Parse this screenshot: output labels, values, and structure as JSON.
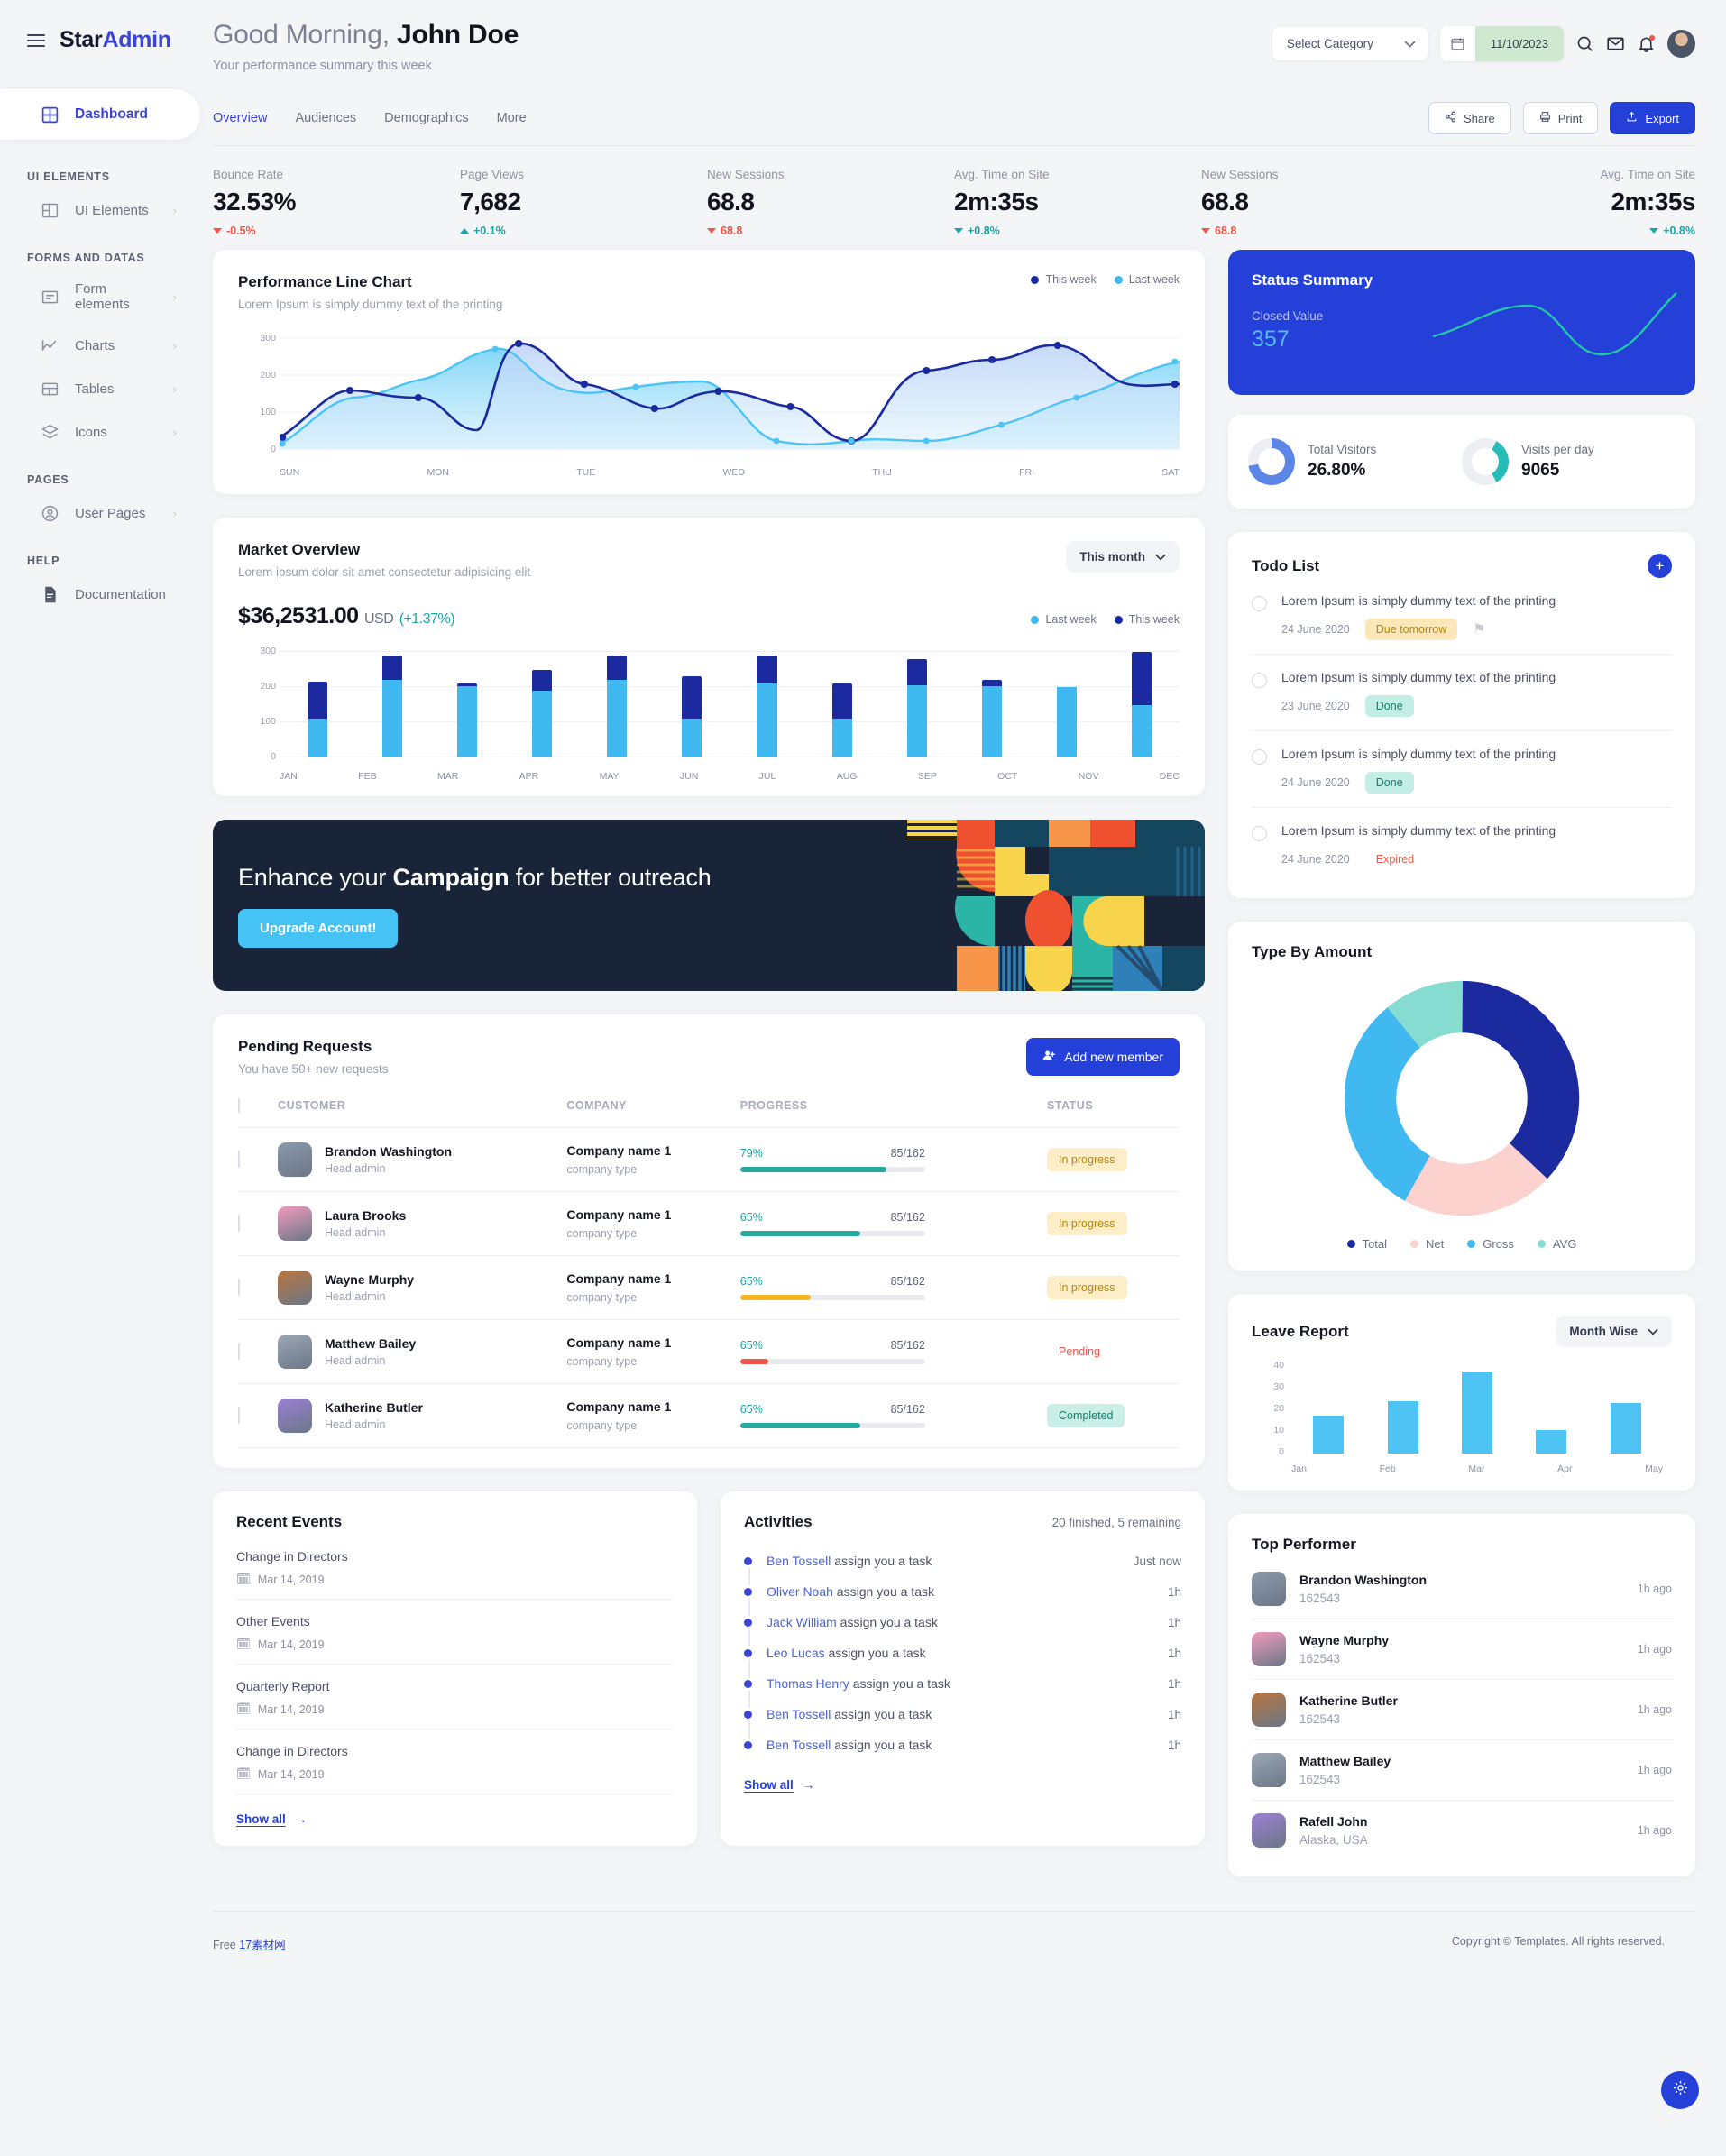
{
  "brand": {
    "star": "Star",
    "admin": "Admin"
  },
  "sidebar": {
    "active": {
      "label": "Dashboard",
      "icon": "grid-icon"
    },
    "sections": [
      {
        "title": "UI ELEMENTS",
        "items": [
          {
            "label": "UI Elements",
            "icon": "layout-icon"
          }
        ]
      },
      {
        "title": "FORMS AND DATAS",
        "items": [
          {
            "label": "Form elements",
            "icon": "form-icon"
          },
          {
            "label": "Charts",
            "icon": "chart-line-icon"
          },
          {
            "label": "Tables",
            "icon": "table-icon"
          },
          {
            "label": "Icons",
            "icon": "layers-icon"
          }
        ]
      },
      {
        "title": "PAGES",
        "items": [
          {
            "label": "User Pages",
            "icon": "user-circle-icon"
          }
        ]
      },
      {
        "title": "HELP",
        "items": [
          {
            "label": "Documentation",
            "icon": "document-icon"
          }
        ]
      }
    ]
  },
  "header": {
    "greeting_prefix": "Good Morning, ",
    "greeting_name": "John Doe",
    "subtitle": "Your performance summary this week",
    "category_select": "Select Category",
    "date_value": "11/10/2023"
  },
  "tabs": [
    {
      "label": "Overview",
      "active": true
    },
    {
      "label": "Audiences",
      "active": false
    },
    {
      "label": "Demographics",
      "active": false
    },
    {
      "label": "More",
      "active": false
    }
  ],
  "actions": {
    "share": "Share",
    "print": "Print",
    "export": "Export"
  },
  "kpis": [
    {
      "label": "Bounce Rate",
      "value": "32.53%",
      "delta": "-0.5%",
      "dir": "down"
    },
    {
      "label": "Page Views",
      "value": "7,682",
      "delta": "+0.1%",
      "dir": "up"
    },
    {
      "label": "New Sessions",
      "value": "68.8",
      "delta": "68.8",
      "dir": "down"
    },
    {
      "label": "Avg. Time on Site",
      "value": "2m:35s",
      "delta": "+0.8%",
      "dir": "up-teal"
    },
    {
      "label": "New Sessions",
      "value": "68.8",
      "delta": "68.8",
      "dir": "down"
    },
    {
      "label": "Avg. Time on Site",
      "value": "2m:35s",
      "delta": "+0.8%",
      "dir": "up-teal"
    }
  ],
  "performance": {
    "title": "Performance Line Chart",
    "subtitle": "Lorem Ipsum is simply dummy text of the printing",
    "legend": [
      {
        "label": "This week",
        "color": "#1b2a9e"
      },
      {
        "label": "Last week",
        "color": "#3fb9f0"
      }
    ]
  },
  "market": {
    "title": "Market Overview",
    "subtitle": "Lorem ipsum dolor sit amet consectetur adipisicing elit",
    "period": "This month",
    "amount": "$36,2531.00",
    "currency": "USD",
    "change": "(+1.37%)",
    "legend": [
      {
        "label": "Last week",
        "color": "#3fb9f0"
      },
      {
        "label": "This week",
        "color": "#1b2a9e"
      }
    ]
  },
  "banner": {
    "text_a": "Enhance your ",
    "text_b": "Campaign",
    "text_c": " for better outreach",
    "button": "Upgrade Account!"
  },
  "pending": {
    "title": "Pending Requests",
    "subtitle": "You have 50+ new requests",
    "add_button": "Add new member",
    "columns": [
      "CUSTOMER",
      "COMPANY",
      "PROGRESS",
      "STATUS"
    ],
    "rows": [
      {
        "name": "Brandon Washington",
        "role": "Head admin",
        "company": "Company name 1",
        "ctype": "company type",
        "pct": "79%",
        "frac": "85/162",
        "fill": 79,
        "bar_color": "#27a9a0",
        "status": "In progress",
        "status_bg": "#fdeec8",
        "status_fg": "#b8860b",
        "avatar": "#8a99ab"
      },
      {
        "name": "Laura Brooks",
        "role": "Head admin",
        "company": "Company name 1",
        "ctype": "company type",
        "pct": "65%",
        "frac": "85/162",
        "fill": 65,
        "bar_color": "#27a9a0",
        "status": "In progress",
        "status_bg": "#fdeec8",
        "status_fg": "#b8860b",
        "avatar": "#f09bbd"
      },
      {
        "name": "Wayne Murphy",
        "role": "Head admin",
        "company": "Company name 1",
        "ctype": "company type",
        "pct": "65%",
        "frac": "85/162",
        "fill": 38,
        "bar_color": "#f5b622",
        "status": "In progress",
        "status_bg": "#fdeec8",
        "status_fg": "#b8860b",
        "avatar": "#b9763e"
      },
      {
        "name": "Matthew Bailey",
        "role": "Head admin",
        "company": "Company name 1",
        "ctype": "company type",
        "pct": "65%",
        "frac": "85/162",
        "fill": 15,
        "bar_color": "#f0564a",
        "status": "Pending",
        "status_bg": "transparent",
        "status_fg": "#f0564a",
        "avatar": "#9aa7b4"
      },
      {
        "name": "Katherine Butler",
        "role": "Head admin",
        "company": "Company name 1",
        "ctype": "company type",
        "pct": "65%",
        "frac": "85/162",
        "fill": 65,
        "bar_color": "#27a9a0",
        "status": "Completed",
        "status_bg": "#c9efe8",
        "status_fg": "#17806f",
        "avatar": "#9b7fd4"
      }
    ]
  },
  "status_summary": {
    "title": "Status Summary",
    "label": "Closed Value",
    "value": "357"
  },
  "visitors": [
    {
      "label": "Total Visitors",
      "value": "26.80%",
      "color": "#5b86e5",
      "pct": 72
    },
    {
      "label": "Visits per day",
      "value": "9065",
      "color": "#26bdb8",
      "pct": 42
    }
  ],
  "todo": {
    "title": "Todo List",
    "items": [
      {
        "text": "Lorem Ipsum is simply dummy text of the printing",
        "date": "24 June 2020",
        "badge": "Due tomorrow",
        "bg": "#fbe7b8",
        "fg": "#b8860b",
        "flag": true
      },
      {
        "text": "Lorem Ipsum is simply dummy text of the printing",
        "date": "23 June 2020",
        "badge": "Done",
        "bg": "#c2eee6",
        "fg": "#17806f",
        "flag": false
      },
      {
        "text": "Lorem Ipsum is simply dummy text of the printing",
        "date": "24 June 2020",
        "badge": "Done",
        "bg": "#c2eee6",
        "fg": "#17806f",
        "flag": false
      },
      {
        "text": "Lorem Ipsum is simply dummy text of the printing",
        "date": "24 June 2020",
        "badge": "Expired",
        "bg": "transparent",
        "fg": "#f0564a",
        "flag": false
      }
    ]
  },
  "type_by_amount": {
    "title": "Type By Amount"
  },
  "leave_report": {
    "title": "Leave Report",
    "period": "Month Wise"
  },
  "recent_events": {
    "title": "Recent Events",
    "show_all": "Show all",
    "items": [
      {
        "title": "Change in Directors",
        "date": "Mar 14, 2019"
      },
      {
        "title": "Other Events",
        "date": "Mar 14, 2019"
      },
      {
        "title": "Quarterly Report",
        "date": "Mar 14, 2019"
      },
      {
        "title": "Change in Directors",
        "date": "Mar 14, 2019"
      }
    ]
  },
  "activities": {
    "title": "Activities",
    "count": "20 finished, 5 remaining",
    "show_all": "Show all",
    "items": [
      {
        "name": "Ben Tossell",
        "action": " assign you a task",
        "time": "Just now"
      },
      {
        "name": "Oliver Noah",
        "action": " assign you a task",
        "time": "1h"
      },
      {
        "name": "Jack William",
        "action": " assign you a task",
        "time": "1h"
      },
      {
        "name": "Leo Lucas",
        "action": " assign you a task",
        "time": "1h"
      },
      {
        "name": "Thomas Henry",
        "action": " assign you a task",
        "time": "1h"
      },
      {
        "name": "Ben Tossell",
        "action": " assign you a task",
        "time": "1h"
      },
      {
        "name": "Ben Tossell",
        "action": " assign you a task",
        "time": "1h"
      }
    ]
  },
  "top_performer": {
    "title": "Top Performer",
    "items": [
      {
        "name": "Brandon Washington",
        "info": "162543",
        "time": "1h ago",
        "avatar": "#8a99ab"
      },
      {
        "name": "Wayne Murphy",
        "info": "162543",
        "time": "1h ago",
        "avatar": "#f09bbd"
      },
      {
        "name": "Katherine Butler",
        "info": "162543",
        "time": "1h ago",
        "avatar": "#b9763e"
      },
      {
        "name": "Matthew Bailey",
        "info": "162543",
        "time": "1h ago",
        "avatar": "#9aa7b4"
      },
      {
        "name": "Rafell John",
        "info": "Alaska, USA",
        "time": "1h ago",
        "avatar": "#9b7fd4"
      }
    ]
  },
  "footer": {
    "free": "Free",
    "link": "17素材网",
    "copyright": "Copyright © Templates. All rights reserved."
  },
  "chart_data": [
    {
      "type": "line",
      "title": "Performance Line Chart",
      "xlabel": "",
      "ylabel": "",
      "categories": [
        "SUN",
        "MON",
        "TUE",
        "WED",
        "THU",
        "FRI",
        "SAT"
      ],
      "x": [
        0,
        1,
        2,
        3,
        4,
        5,
        6,
        7,
        8,
        9,
        10,
        11,
        12,
        13
      ],
      "ylim": [
        0,
        320
      ],
      "yticks": [
        0,
        100,
        200,
        300
      ],
      "grid": true,
      "legend_position": "top-right",
      "series": [
        {
          "name": "This week",
          "color": "#1b2a9e",
          "values": [
            52,
            110,
            60,
            293,
            201,
            112,
            130,
            171,
            89,
            210,
            240,
            283,
            201
          ]
        },
        {
          "name": "Last week",
          "color": "#3fb9f0",
          "values": [
            30,
            175,
            200,
            250,
            160,
            150,
            140,
            18,
            31,
            15,
            40,
            95,
            180
          ]
        }
      ]
    },
    {
      "type": "bar",
      "title": "Market Overview",
      "xlabel": "",
      "ylabel": "",
      "categories": [
        "JAN",
        "FEB",
        "MAR",
        "APR",
        "MAY",
        "JUN",
        "JUL",
        "AUG",
        "SEP",
        "OCT",
        "NOV",
        "DEC"
      ],
      "ylim": [
        0,
        300
      ],
      "yticks": [
        0,
        100,
        200,
        300
      ],
      "grid": true,
      "stacked": true,
      "legend_position": "top-right",
      "series": [
        {
          "name": "Last week",
          "color": "#3fb9f0",
          "values": [
            110,
            220,
            203,
            190,
            220,
            110,
            210,
            110,
            205,
            203,
            201,
            150
          ]
        },
        {
          "name": "This week",
          "color": "#1b2a9e",
          "values": [
            105,
            70,
            8,
            60,
            70,
            120,
            80,
            100,
            75,
            18,
            0,
            150
          ]
        }
      ]
    },
    {
      "type": "pie",
      "title": "Type By Amount",
      "legend_position": "bottom",
      "labels": [
        "Total",
        "Net",
        "Gross",
        "AVG"
      ],
      "values": [
        37,
        21,
        31,
        11
      ],
      "colors": [
        "#1b2a9e",
        "#fbd2cd",
        "#3fb9f0",
        "#86dcd0"
      ]
    },
    {
      "type": "bar",
      "title": "Leave Report",
      "categories": [
        "Jan",
        "Feb",
        "Mar",
        "Apr",
        "May"
      ],
      "values": [
        18,
        25,
        39,
        11,
        24
      ],
      "ylim": [
        0,
        42
      ],
      "yticks": [
        0,
        10,
        20,
        30,
        40
      ],
      "color": "#4ec4f5",
      "xlabel": "",
      "ylabel": ""
    },
    {
      "type": "line",
      "title": "Status Summary",
      "values": [
        40,
        55,
        68,
        72,
        60,
        35,
        28,
        32,
        55,
        80
      ],
      "color": "#22c9a8",
      "grid": false
    }
  ]
}
